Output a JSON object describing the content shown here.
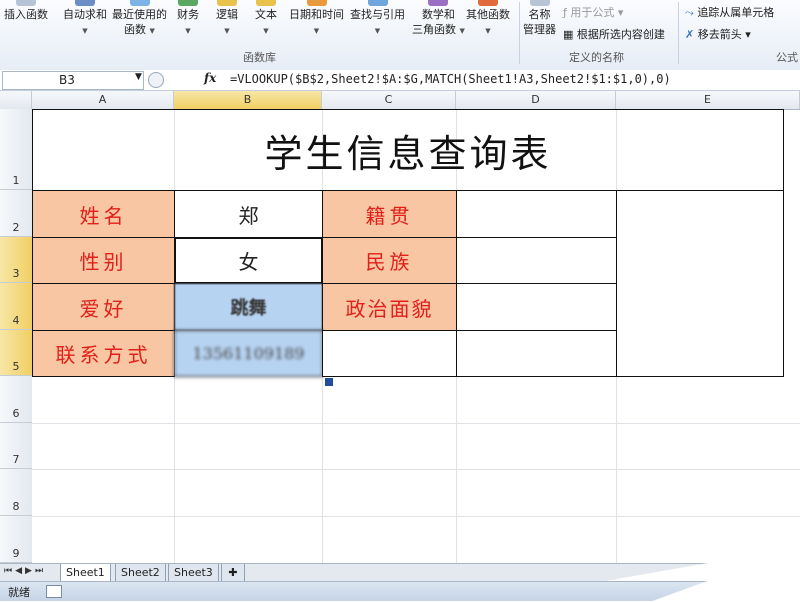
{
  "ribbon": {
    "insert_function": "插入函数",
    "autosum": "自动求和",
    "recent_1": "最近使用的",
    "recent_2": "函数",
    "financial": "财务",
    "logical": "逻辑",
    "text": "文本",
    "datetime": "日期和时间",
    "lookup": "查找与引用",
    "math_1": "数学和",
    "math_2": "三角函数",
    "more": "其他函数",
    "group_library": "函数库",
    "name_mgr_1": "名称",
    "name_mgr_2": "管理器",
    "use_in_formula": "用于公式",
    "create_from_sel": "根据所选内容创建",
    "group_names": "定义的名称",
    "trace_precedents": "追踪从属单元格",
    "remove_arrows": "移去箭头",
    "group_audit": "公式"
  },
  "formula_bar": {
    "name_box": "B3",
    "fx": "fx",
    "formula": "=VLOOKUP($B$2,Sheet2!$A:$G,MATCH(Sheet1!A3,Sheet2!$1:$1,0),0)"
  },
  "columns": [
    "A",
    "B",
    "C",
    "D",
    "E"
  ],
  "rows": [
    "1",
    "2",
    "3",
    "4",
    "5",
    "6",
    "7",
    "8",
    "9"
  ],
  "sheet": {
    "title": "学生信息查询表",
    "label_name": "姓名",
    "value_name": "郑",
    "label_native": "籍贯",
    "label_gender": "性别",
    "value_gender": "女",
    "label_ethnic": "民族",
    "label_hobby": "爱好",
    "value_hobby": "跳舞",
    "label_political": "政治面貌",
    "label_contact": "联系方式",
    "value_contact": "13561109189"
  },
  "tabs": [
    "Sheet1",
    "Sheet2",
    "Sheet3"
  ],
  "status": {
    "ready": "就绪"
  },
  "colors": {
    "label_fill": "#f8c6a3",
    "label_text": "#e0201a",
    "selection": "#b7d3f2"
  }
}
